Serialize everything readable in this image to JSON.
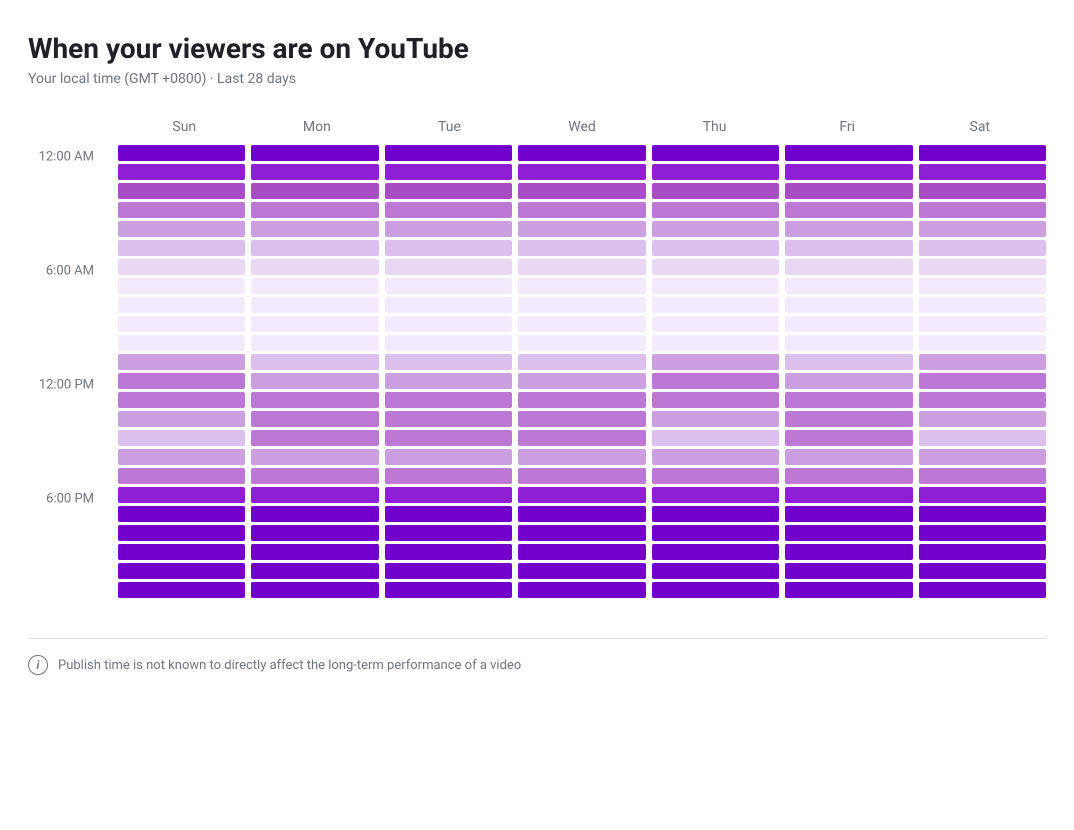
{
  "title": "When your viewers are on YouTube",
  "subtitle": "Your local time (GMT +0800) · Last 28 days",
  "days": [
    "Sun",
    "Mon",
    "Tue",
    "Wed",
    "Thu",
    "Fri",
    "Sat"
  ],
  "y_labels": [
    "12:00 AM",
    "6:00 AM",
    "12:00 PM",
    "6:00 PM"
  ],
  "footer_text": "Publish time is not known to directly affect the long-term performance of a video",
  "colors": {
    "max": "#7b00d4",
    "high": "#9c27b0",
    "mid_high": "#b565d3",
    "mid": "#cc99e0",
    "mid_low": "#dbb8ea",
    "low": "#e8d0f3",
    "very_low": "#f2e6f9",
    "min": "#f8f2fd"
  },
  "heatmap": {
    "Sun": [
      "max",
      "high",
      "mid_high",
      "mid",
      "mid_low",
      "low",
      "very_low",
      "min",
      "min",
      "min",
      "min",
      "mid_low",
      "mid",
      "mid",
      "mid_low",
      "low",
      "mid_low",
      "mid",
      "high",
      "max",
      "max",
      "max",
      "max",
      "max"
    ],
    "Mon": [
      "max",
      "high",
      "mid_high",
      "mid",
      "mid_low",
      "low",
      "very_low",
      "min",
      "min",
      "min",
      "min",
      "low",
      "mid_low",
      "mid",
      "mid",
      "mid",
      "mid_low",
      "mid",
      "high",
      "max",
      "max",
      "max",
      "max",
      "max"
    ],
    "Tue": [
      "max",
      "high",
      "mid_high",
      "mid",
      "mid_low",
      "low",
      "very_low",
      "min",
      "min",
      "min",
      "min",
      "low",
      "mid_low",
      "mid",
      "mid",
      "mid",
      "mid_low",
      "mid",
      "high",
      "max",
      "max",
      "max",
      "max",
      "max"
    ],
    "Wed": [
      "max",
      "high",
      "mid_high",
      "mid",
      "mid_low",
      "low",
      "very_low",
      "min",
      "min",
      "min",
      "min",
      "low",
      "mid_low",
      "mid",
      "mid",
      "mid",
      "mid_low",
      "mid",
      "high",
      "max",
      "max",
      "max",
      "max",
      "max"
    ],
    "Thu": [
      "max",
      "high",
      "mid_high",
      "mid",
      "mid_low",
      "low",
      "very_low",
      "min",
      "min",
      "min",
      "min",
      "mid_low",
      "mid",
      "mid",
      "mid_low",
      "low",
      "mid_low",
      "mid",
      "high",
      "max",
      "max",
      "max",
      "max",
      "max"
    ],
    "Fri": [
      "max",
      "high",
      "mid_high",
      "mid",
      "mid_low",
      "low",
      "very_low",
      "min",
      "min",
      "min",
      "min",
      "low",
      "mid_low",
      "mid",
      "mid",
      "mid",
      "mid_low",
      "mid",
      "high",
      "max",
      "max",
      "max",
      "max",
      "max"
    ],
    "Sat": [
      "max",
      "high",
      "mid_high",
      "mid",
      "mid_low",
      "low",
      "very_low",
      "min",
      "min",
      "min",
      "min",
      "mid_low",
      "mid",
      "mid",
      "mid_low",
      "low",
      "mid_low",
      "mid",
      "high",
      "max",
      "max",
      "max",
      "max",
      "max"
    ]
  },
  "color_map": {
    "max": "#7200ca",
    "high": "#8f1fd4",
    "mid_high": "#a94dc4",
    "mid": "#bc78d4",
    "mid_low": "#cca0e0",
    "low": "#dbbfed",
    "very_low": "#e9d8f5",
    "min": "#f3ebfb"
  }
}
